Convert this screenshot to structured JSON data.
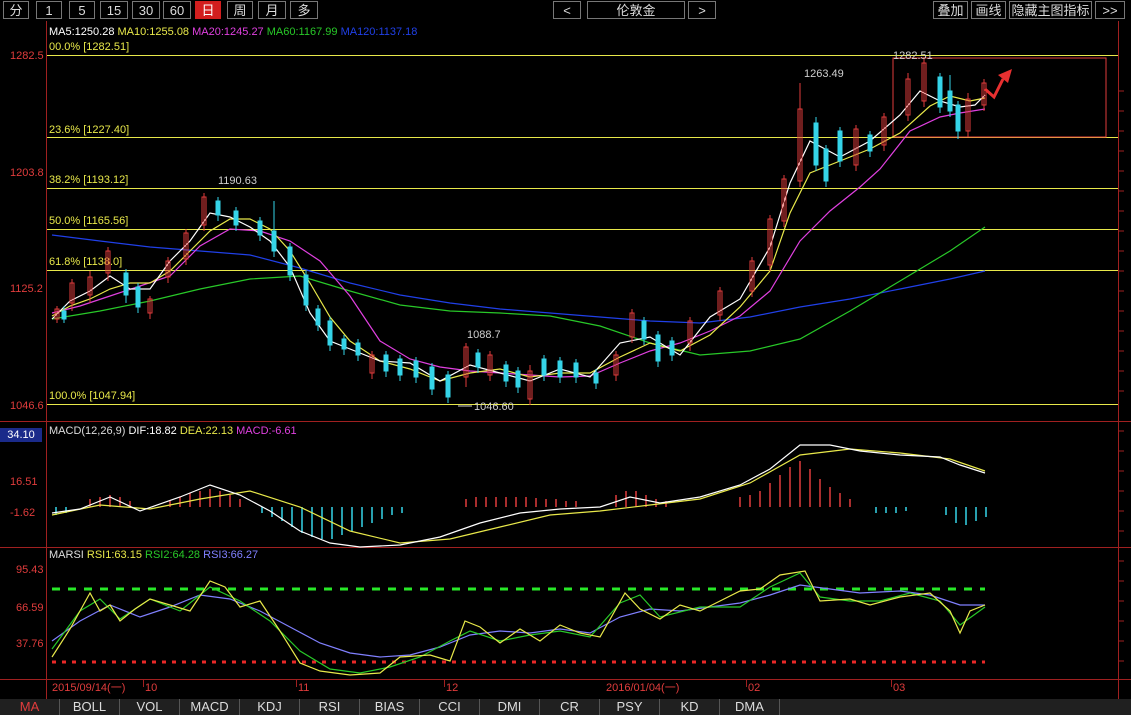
{
  "toolbar": {
    "periods": [
      "分",
      "1",
      "5",
      "15",
      "30",
      "60",
      "日",
      "周",
      "月",
      "多"
    ],
    "active_period": "日",
    "prev_label": "<",
    "symbol": "伦敦金",
    "next_label": ">",
    "overlay_label": "叠加",
    "draw_label": "画线",
    "hide_indicator_label": "隐藏主图指标",
    "more_label": ">>"
  },
  "main_chart": {
    "ma_header": {
      "ma5": "MA5:1250.28",
      "ma10": "MA10:1255.08",
      "ma20": "MA20:1245.27",
      "ma60": "MA60:1167.99",
      "ma120": "MA120:1137.18"
    },
    "y_ticks": [
      "1282.5",
      "1203.8",
      "1125.2",
      "1046.6"
    ],
    "fib_levels": [
      {
        "label": "00.0% [1282.51]",
        "value": 1282.51
      },
      {
        "label": "23.6% [1227.40]",
        "value": 1227.4
      },
      {
        "label": "38.2% [1193.12]",
        "value": 1193.12
      },
      {
        "label": "50.0% [1165.56]",
        "value": 1165.56
      },
      {
        "label": "61.8% [1138.0]",
        "value": 1138.0
      },
      {
        "label": "100.0% [1047.94]",
        "value": 1047.94
      }
    ],
    "annotations": [
      "1190.63",
      "1263.49",
      "1282.51",
      "1088.7",
      "1046.60"
    ]
  },
  "macd": {
    "header": {
      "name": "MACD(12,26,9)",
      "dif": "DIF:18.82",
      "dea": "DEA:22.13",
      "macd": "MACD:-6.61"
    },
    "y_ticks": [
      "34.10",
      "16.51",
      "-1.62"
    ]
  },
  "rsi": {
    "header": {
      "name": "MARSI",
      "rsi1": "RSI1:63.15",
      "rsi2": "RSI2:64.28",
      "rsi3": "RSI3:66.27"
    },
    "y_ticks": [
      "95.43",
      "66.59",
      "37.76"
    ]
  },
  "x_axis": {
    "labels": [
      "2015/09/14(一)",
      "10",
      "11",
      "12",
      "2016/01/04(一)",
      "02",
      "03"
    ]
  },
  "tabs": {
    "items": [
      "MA",
      "BOLL",
      "VOL",
      "MACD",
      "KDJ",
      "RSI",
      "BIAS",
      "CCI",
      "DMI",
      "CR",
      "PSY",
      "KD",
      "DMA"
    ],
    "active": "MA"
  },
  "colors": {
    "bull": "#e03c3c",
    "bear": "#35d4e8",
    "ma5": "#ffffff",
    "ma10": "#e8e84a",
    "ma20": "#e040e0",
    "ma60": "#28c828",
    "ma120": "#2040e8",
    "fib": "#e8e84a"
  }
}
